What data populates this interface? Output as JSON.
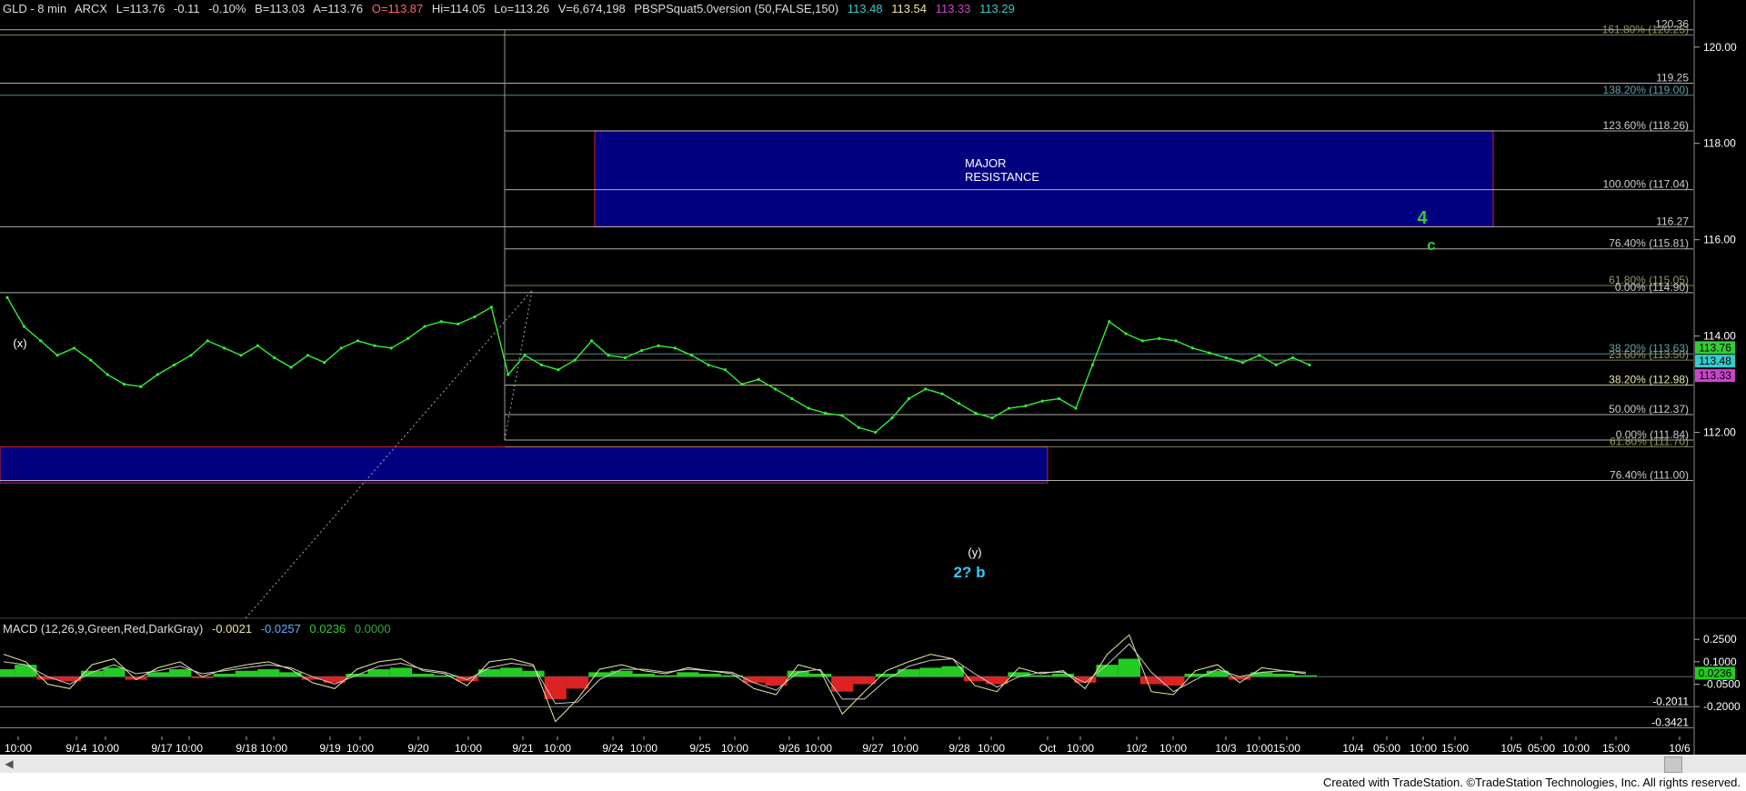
{
  "header": {
    "symbol": "GLD - 8 min",
    "exchange": "ARCX",
    "last": "L=113.76",
    "change": "-0.11",
    "change_pct": "-0.10%",
    "bid": "B=113.03",
    "ask": "A=113.76",
    "open": "O=113.87",
    "high": "Hi=114.05",
    "low": "Lo=113.26",
    "volume": "V=6,674,198",
    "indicator": "PBSPSquat5.0version (50,FALSE,150)",
    "ind_values": [
      "113.48",
      "113.54",
      "113.33",
      "113.29"
    ],
    "ind_colors": [
      "#33cccc",
      "#e8e8a0",
      "#cc44cc",
      "#33cccc"
    ]
  },
  "macd_header": {
    "label": "MACD (12,26,9,Green,Red,DarkGray)",
    "values": [
      "-0.0021",
      "-0.0257",
      "0.0236",
      "0.0000"
    ],
    "colors": [
      "#e8e8a0",
      "#66aaff",
      "#33cc33",
      "#33aa33"
    ]
  },
  "footer": {
    "credit": "Created with TradeStation. ©TradeStation Technologies, Inc. All rights reserved."
  },
  "chart_data": {
    "type": "line",
    "title": "GLD - 8 min",
    "price_axis": {
      "ylim": [
        110.5,
        120.6
      ],
      "ticks": [
        "120.00",
        "118.00",
        "116.00",
        "114.00",
        "112.00"
      ]
    },
    "x_tick_labels": [
      "10:00",
      "9/14",
      "10:00",
      "9/17",
      "10:00",
      "9/18",
      "10:00",
      "9/19",
      "10:00",
      "9/20",
      "10:00",
      "9/21",
      "10:00",
      "9/24",
      "10:00",
      "9/25",
      "10:00",
      "9/26",
      "10:00",
      "9/27",
      "10:00",
      "9/28",
      "10:00",
      "Oct",
      "10:00",
      "10/2",
      "10:00",
      "10/3",
      "10:00",
      "15:00",
      "10/4",
      "05:00",
      "10:00",
      "15:00",
      "10/5",
      "05:00",
      "10:00",
      "15:00",
      "10/6"
    ],
    "price_series": {
      "name": "GLD",
      "color": "#33ee33",
      "values": [
        114.8,
        114.2,
        113.9,
        113.6,
        113.75,
        113.5,
        113.2,
        113.0,
        112.95,
        113.2,
        113.4,
        113.6,
        113.9,
        113.75,
        113.6,
        113.8,
        113.55,
        113.35,
        113.6,
        113.45,
        113.75,
        113.9,
        113.8,
        113.75,
        113.95,
        114.2,
        114.3,
        114.25,
        114.4,
        114.6,
        113.2,
        113.6,
        113.4,
        113.3,
        113.5,
        113.9,
        113.6,
        113.55,
        113.7,
        113.8,
        113.75,
        113.6,
        113.4,
        113.3,
        113.0,
        113.1,
        112.9,
        112.7,
        112.5,
        112.4,
        112.35,
        112.1,
        112.0,
        112.3,
        112.7,
        112.9,
        112.8,
        112.6,
        112.4,
        112.3,
        112.5,
        112.55,
        112.65,
        112.7,
        112.5,
        113.4,
        114.3,
        114.05,
        113.9,
        113.95,
        113.9,
        113.75,
        113.65,
        113.55,
        113.45,
        113.6,
        113.4,
        113.55,
        113.4
      ]
    },
    "horizontal_levels": [
      {
        "label": "120.36",
        "value": 120.36,
        "color": "#cccccc"
      },
      {
        "label": "161.80% (120.25)",
        "value": 120.25,
        "color": "#999966"
      },
      {
        "label": "119.25",
        "value": 119.25,
        "color": "#cccccc"
      },
      {
        "label": "138.20% (119.00)",
        "value": 119.0,
        "color": "#5fa0b0"
      },
      {
        "label": "123.60% (118.26)",
        "value": 118.26,
        "color": "#cccccc"
      },
      {
        "label": "100.00% (117.04)",
        "value": 117.04,
        "color": "#cccccc"
      },
      {
        "label": "116.27",
        "value": 116.27,
        "color": "#cccccc"
      },
      {
        "label": "76.40% (115.81)",
        "value": 115.81,
        "color": "#cccccc"
      },
      {
        "label": "61.80% (115.05)",
        "value": 115.05,
        "color": "#999966"
      },
      {
        "label": "0.00% (114.90)",
        "value": 114.9,
        "color": "#cccccc"
      },
      {
        "label": "38.20% (113.63)",
        "value": 113.63,
        "color": "#5fa0b0"
      },
      {
        "label": "23.60% (113.50)",
        "value": 113.5,
        "color": "#999966"
      },
      {
        "label": "38.20% (112.98)",
        "value": 112.98,
        "color": "#e8e8a0"
      },
      {
        "label": "50.00% (112.37)",
        "value": 112.37,
        "color": "#cccccc"
      },
      {
        "label": "0.00% (111.84)",
        "value": 111.84,
        "color": "#cccccc"
      },
      {
        "label": "61.80% (111.70)",
        "value": 111.7,
        "color": "#999966"
      },
      {
        "label": "76.40% (111.00)",
        "value": 111.0,
        "color": "#cccccc"
      }
    ],
    "zones": [
      {
        "label": "MAJOR RESISTANCE",
        "label_lines": [
          "MAJOR",
          "RESISTANCE"
        ],
        "from": 116.27,
        "to": 118.26
      },
      {
        "label": "",
        "label_lines": [],
        "from": 110.95,
        "to": 111.7
      }
    ],
    "wave_labels": [
      {
        "text": "(x)",
        "color": "#ffffff"
      },
      {
        "text": "(y)",
        "color": "#ffffff"
      },
      {
        "text": "2? b",
        "color": "#33ccff"
      },
      {
        "text": "4",
        "color": "#33cc33"
      },
      {
        "text": "c",
        "color": "#33cc33"
      }
    ],
    "price_markers": [
      {
        "label": "113.76",
        "color": "#33cc33"
      },
      {
        "label": "113.48",
        "color": "#33cccc"
      },
      {
        "label": "113.33",
        "color": "#cc44cc"
      }
    ],
    "macd": {
      "ylim": [
        -0.4,
        0.3
      ],
      "ticks": [
        "0.2500",
        "0.1000",
        "-0.0500",
        "-0.2000"
      ],
      "level_labels": [
        "-0.2011",
        "-0.3421"
      ],
      "marker": "0.0236",
      "histogram": [
        0.05,
        0.08,
        -0.02,
        -0.03,
        0.04,
        0.06,
        -0.02,
        0.03,
        0.05,
        -0.01,
        0.02,
        0.04,
        0.05,
        0.03,
        -0.02,
        -0.04,
        0.02,
        0.05,
        0.06,
        0.02,
        0.01,
        -0.03,
        0.05,
        0.06,
        0.04,
        -0.15,
        -0.08,
        0.03,
        0.04,
        0.02,
        0.01,
        0.03,
        0.02,
        0.01,
        -0.04,
        -0.06,
        0.04,
        0.02,
        -0.1,
        -0.05,
        0.02,
        0.05,
        0.06,
        0.07,
        -0.03,
        -0.05,
        0.03,
        0.01,
        0.02,
        -0.04,
        0.08,
        0.12,
        -0.05,
        -0.06,
        0.02,
        0.04,
        -0.02,
        0.03,
        0.02,
        0.01
      ],
      "macd_line": [
        0.15,
        0.1,
        -0.05,
        -0.08,
        0.08,
        0.12,
        -0.02,
        0.06,
        0.1,
        0.0,
        0.05,
        0.08,
        0.1,
        0.05,
        -0.04,
        -0.08,
        0.05,
        0.1,
        0.12,
        0.04,
        0.02,
        -0.06,
        0.1,
        0.12,
        0.08,
        -0.3,
        -0.15,
        0.05,
        0.08,
        0.04,
        0.02,
        0.06,
        0.04,
        0.02,
        -0.08,
        -0.12,
        0.08,
        0.04,
        -0.25,
        -0.1,
        0.04,
        0.1,
        0.15,
        0.12,
        -0.06,
        -0.1,
        0.06,
        0.02,
        0.04,
        -0.08,
        0.15,
        0.28,
        -0.1,
        -0.12,
        0.04,
        0.08,
        -0.04,
        0.06,
        0.04,
        0.02
      ],
      "signal_line": [
        0.1,
        0.08,
        0.0,
        -0.05,
        0.03,
        0.08,
        0.02,
        0.04,
        0.07,
        0.02,
        0.04,
        0.06,
        0.08,
        0.06,
        0.0,
        -0.05,
        0.01,
        0.07,
        0.09,
        0.05,
        0.03,
        -0.02,
        0.06,
        0.09,
        0.07,
        -0.18,
        -0.17,
        -0.02,
        0.05,
        0.05,
        0.03,
        0.05,
        0.04,
        0.03,
        -0.04,
        -0.09,
        0.03,
        0.05,
        -0.15,
        -0.15,
        -0.02,
        0.07,
        0.11,
        0.12,
        0.02,
        -0.07,
        0.0,
        0.03,
        0.03,
        -0.04,
        0.08,
        0.22,
        0.03,
        -0.1,
        -0.02,
        0.05,
        0.0,
        0.03,
        0.04,
        0.03
      ]
    }
  },
  "colors": {
    "background": "#000000",
    "zone_fill": "#000080",
    "zone_border": "#cc2222",
    "price": "#33ee33",
    "grid": "#555555",
    "axis_text": "#ffffff"
  }
}
